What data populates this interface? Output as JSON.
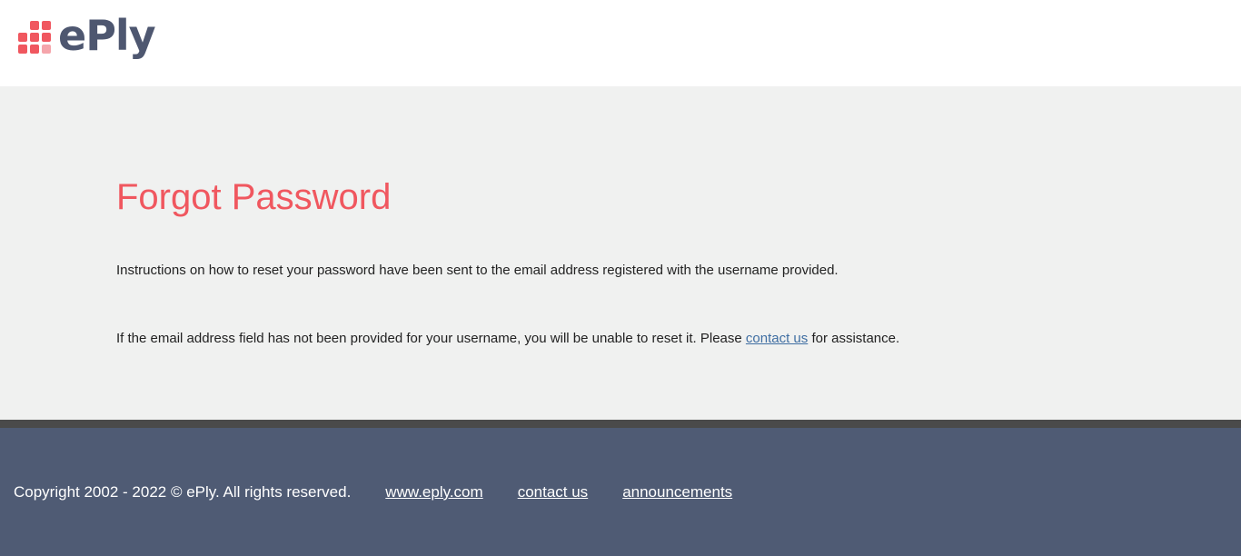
{
  "header": {
    "logo_text": "ePly"
  },
  "main": {
    "title": "Forgot Password",
    "message1": "Instructions on how to reset your password have been sent to the email address registered with the username provided.",
    "message2_before": "If the email address field has not been provided for your username, you will be unable to reset it. Please ",
    "message2_link": "contact us",
    "message2_after": " for assistance."
  },
  "footer": {
    "copyright": "Copyright 2002 - 2022 © ePly. All rights reserved.",
    "links": [
      "www.eply.com",
      "contact us",
      "announcements"
    ]
  },
  "colors": {
    "accent": "#f0575f",
    "footer_bg": "#4f5b74",
    "link": "#3f6ea2"
  }
}
